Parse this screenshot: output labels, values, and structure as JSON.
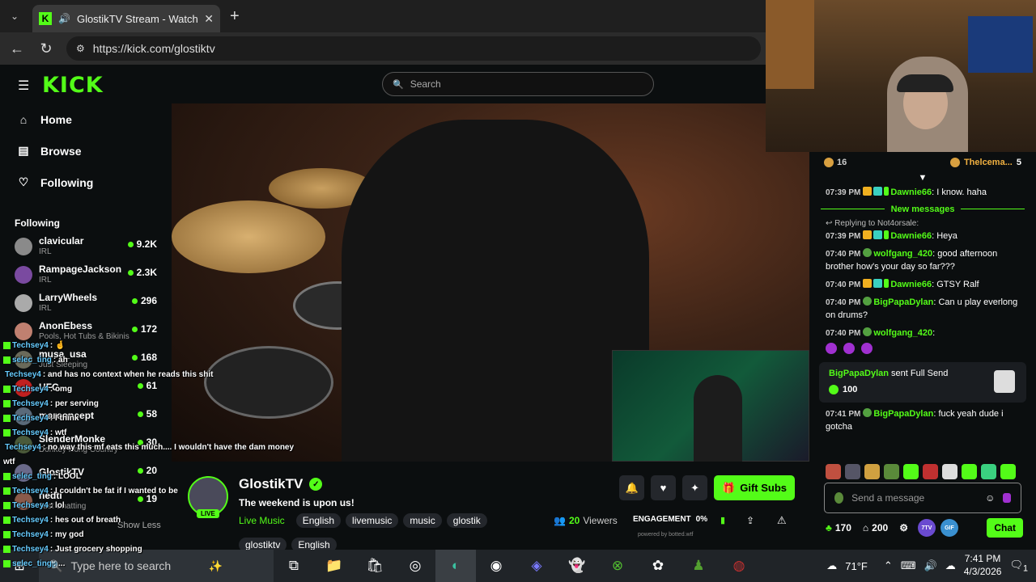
{
  "browser": {
    "tab_title": "GlostikTV Stream - Watch Live",
    "tab_favicon": "K",
    "url": "https://kick.com/glostiktv"
  },
  "header": {
    "logo": "KICK",
    "search_placeholder": "Search"
  },
  "sidebar": {
    "nav": [
      {
        "label": "Home",
        "icon": "home-icon"
      },
      {
        "label": "Browse",
        "icon": "browse-icon"
      },
      {
        "label": "Following",
        "icon": "heart-icon"
      }
    ],
    "following_title": "Following",
    "following": [
      {
        "name": "clavicular",
        "category": "IRL",
        "viewers": "9.2K",
        "color": "#8a8a8a"
      },
      {
        "name": "RampageJackson",
        "category": "IRL",
        "viewers": "2.3K",
        "color": "#7a4aa0"
      },
      {
        "name": "LarryWheels",
        "category": "IRL",
        "viewers": "296",
        "color": "#aaaaaa"
      },
      {
        "name": "AnonEbess",
        "category": "Pools, Hot Tubs & Bikinis",
        "viewers": "172",
        "color": "#c08070"
      },
      {
        "name": "musa_usa",
        "category": "Just Sleeping",
        "viewers": "168",
        "color": "#6a6a5a"
      },
      {
        "name": "UFC",
        "category": "",
        "viewers": "61",
        "color": "#c02020"
      },
      {
        "name": "marconcept",
        "category": "",
        "viewers": "58",
        "color": "#5a6a7a"
      },
      {
        "name": "SlenderMonke",
        "category": "Donkey Kong Country",
        "viewers": "30",
        "color": "#4a5a3a"
      },
      {
        "name": "GlostikTV",
        "category": "",
        "viewers": "20",
        "color": "#6a6a8a"
      },
      {
        "name": "nedti",
        "category": "Just Chatting",
        "viewers": "19",
        "color": "#8a5a4a"
      }
    ],
    "show_less": "Show Less"
  },
  "overlay_chat": [
    {
      "user": "Techsey4",
      "text": ": 🤞"
    },
    {
      "user": "selec_ting",
      "text": ": ah"
    },
    {
      "user": "Techsey4",
      "text": ": and has no context when he reads this shit"
    },
    {
      "user": "Techsey4",
      "text": ": omg"
    },
    {
      "user": "Techsey4",
      "text": ": per serving"
    },
    {
      "user": "Techsey4",
      "text": ": I think"
    },
    {
      "user": "Techsey4",
      "text": ": wtf"
    },
    {
      "user": "Techsey4",
      "text": ": no way this mf eats this much.... I wouldn't have the dam money"
    },
    {
      "user": "",
      "text": "wtf"
    },
    {
      "user": "selec_ting",
      "text": ": LOOL"
    },
    {
      "user": "Techsey4",
      "text": ": I couldn't be fat if I wanted to be"
    },
    {
      "user": "Techsey4",
      "text": ": lol"
    },
    {
      "user": "Techsey4",
      "text": ": hes out of breath"
    },
    {
      "user": "Techsey4",
      "text": ": my god"
    },
    {
      "user": "Techsey4",
      "text": ": Just grocery shopping"
    },
    {
      "user": "selec_ting",
      "text": ": ..."
    }
  ],
  "channel": {
    "name": "GlostikTV",
    "live_label": "LIVE",
    "title": "The weekend is upon us!",
    "category": "Live Music",
    "tags": [
      "English",
      "livemusic",
      "music",
      "glostik",
      "glostiktv",
      "English"
    ],
    "viewers_count": "20",
    "viewers_label": "Viewers",
    "engagement_label": "ENGAGEMENT",
    "engagement_value": "0%",
    "powered_by": "powered by botted.wtf",
    "gift_subs_label": "Gift Subs"
  },
  "chat": {
    "leaderboard": {
      "left_count": "16",
      "right_name": "Thelcema...",
      "right_count": "5"
    },
    "messages": [
      {
        "time": "07:39 PM",
        "user": "Dawnie66",
        "color": "#53fc18",
        "badges": [
          "crown",
          "sub",
          "bolt"
        ],
        "text": ": I know. haha"
      }
    ],
    "new_messages_label": "New messages",
    "reply_label": "Replying to Not4orsale:",
    "messages2": [
      {
        "time": "07:39 PM",
        "user": "Dawnie66",
        "color": "#53fc18",
        "badges": [
          "crown",
          "sub",
          "bolt"
        ],
        "text": ": Heya"
      },
      {
        "time": "07:40 PM",
        "user": "wolfgang_420",
        "color": "#53fc18",
        "badges": [
          "mod"
        ],
        "text": ": good afternoon brother how's your day so far???"
      },
      {
        "time": "07:40 PM",
        "user": "Dawnie66",
        "color": "#53fc18",
        "badges": [
          "crown",
          "sub",
          "bolt"
        ],
        "text": ": GTSY Ralf"
      },
      {
        "time": "07:40 PM",
        "user": "BigPapaDylan",
        "color": "#53fc18",
        "badges": [
          "mod"
        ],
        "text": ": Can u play everlong on drums?"
      },
      {
        "time": "07:40 PM",
        "user": "wolfgang_420",
        "color": "#53fc18",
        "badges": [
          "mod"
        ],
        "text": ":"
      }
    ],
    "gift": {
      "user": "BigPapaDylan",
      "action": "sent Full Send",
      "amount": "100"
    },
    "messages3": [
      {
        "time": "07:41 PM",
        "user": "BigPapaDylan",
        "color": "#53fc18",
        "badges": [
          "mod"
        ],
        "text": ": fuck yeah dude i gotcha"
      }
    ],
    "input_placeholder": "Send a message",
    "footer": {
      "points": "170",
      "subs": "200",
      "btn_7tv": "7TV",
      "btn_gif": "GIF",
      "chat_button": "Chat"
    }
  },
  "taskbar": {
    "search_placeholder": "Type here to search",
    "weather": "71°F",
    "time": "7:41 PM",
    "date": "4/3/2026",
    "notification_count": "1"
  }
}
